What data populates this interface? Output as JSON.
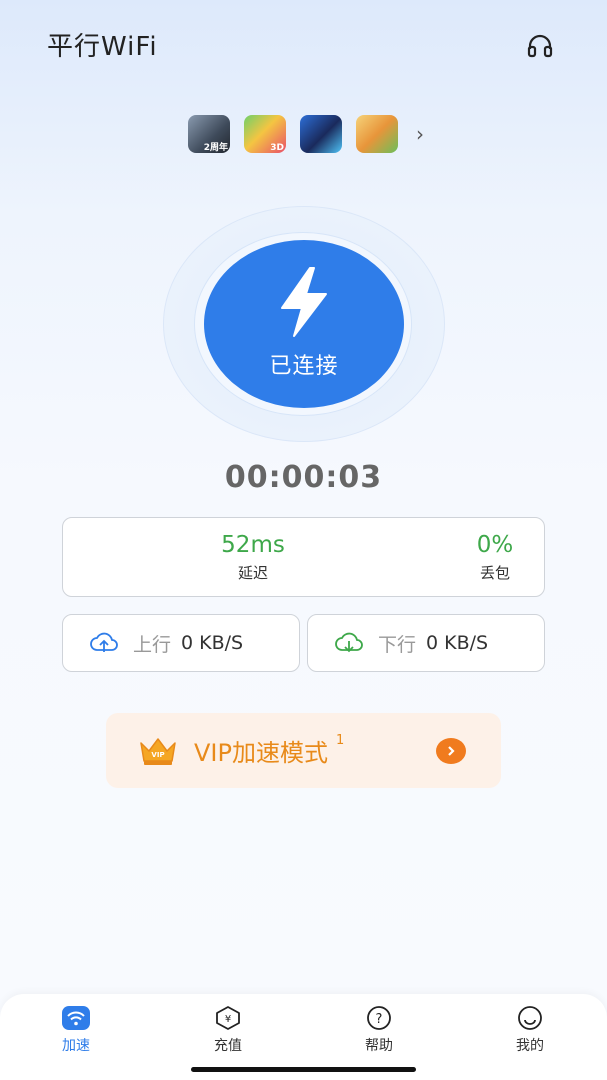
{
  "header": {
    "title": "平行WiFi",
    "support_icon": "headset-icon"
  },
  "games": {
    "items": [
      {
        "icon": "game-icon-1",
        "tag": "2周年"
      },
      {
        "icon": "game-icon-2",
        "tag": "3D"
      },
      {
        "icon": "game-icon-3",
        "tag": ""
      },
      {
        "icon": "game-icon-4",
        "tag": ""
      }
    ],
    "more": "›"
  },
  "connect": {
    "label": "已连接",
    "icon": "lightning-icon",
    "color": "#2f7de9"
  },
  "timer": "00:00:03",
  "stats": {
    "latency": {
      "value": "52ms",
      "label": "延迟"
    },
    "loss": {
      "value": "0%",
      "label": "丢包"
    },
    "value_color": "#3ea84a"
  },
  "speed": {
    "upload": {
      "label": "上行",
      "value": "0 KB/S",
      "icon": "cloud-upload-icon"
    },
    "download": {
      "label": "下行",
      "value": "0 KB/S",
      "icon": "cloud-download-icon"
    }
  },
  "vip": {
    "text": "VIP加速模式",
    "superscript": "1",
    "crown_text": "VIP",
    "accent": "#f07b1e"
  },
  "tabs": [
    {
      "label": "加速",
      "icon": "wifi-icon",
      "active": true
    },
    {
      "label": "充值",
      "icon": "yuan-icon",
      "active": false
    },
    {
      "label": "帮助",
      "icon": "question-icon",
      "active": false
    },
    {
      "label": "我的",
      "icon": "smiley-icon",
      "active": false
    }
  ]
}
